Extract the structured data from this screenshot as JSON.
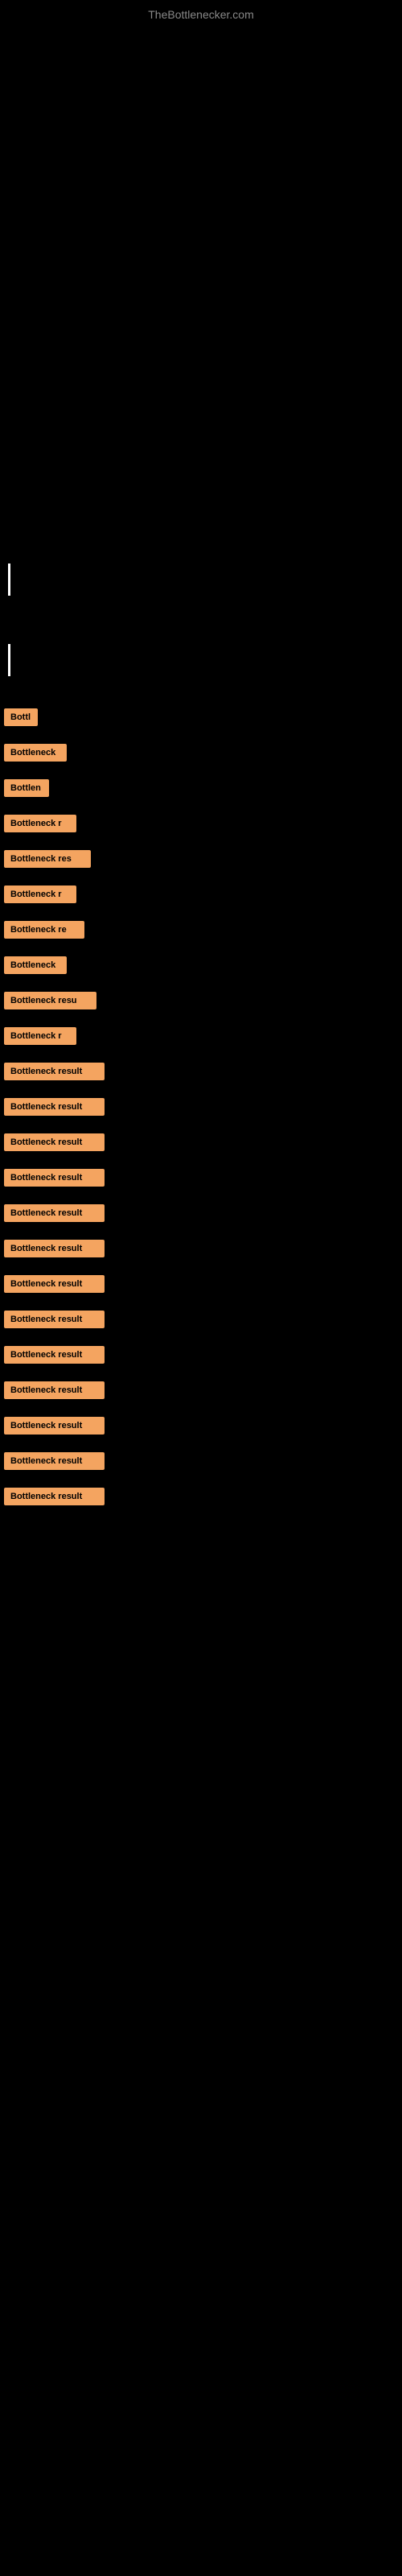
{
  "header": {
    "title": "TheBottlenecker.com"
  },
  "results": [
    {
      "label": "Bottl",
      "width": 42
    },
    {
      "label": "Bottleneck",
      "width": 78
    },
    {
      "label": "Bottlen",
      "width": 56
    },
    {
      "label": "Bottleneck r",
      "width": 90
    },
    {
      "label": "Bottleneck res",
      "width": 108
    },
    {
      "label": "Bottleneck r",
      "width": 90
    },
    {
      "label": "Bottleneck re",
      "width": 100
    },
    {
      "label": "Bottleneck",
      "width": 78
    },
    {
      "label": "Bottleneck resu",
      "width": 115
    },
    {
      "label": "Bottleneck r",
      "width": 90
    },
    {
      "label": "Bottleneck result",
      "width": 125
    },
    {
      "label": "Bottleneck result",
      "width": 125
    },
    {
      "label": "Bottleneck result",
      "width": 125
    },
    {
      "label": "Bottleneck result",
      "width": 125
    },
    {
      "label": "Bottleneck result",
      "width": 125
    },
    {
      "label": "Bottleneck result",
      "width": 125
    },
    {
      "label": "Bottleneck result",
      "width": 125
    },
    {
      "label": "Bottleneck result",
      "width": 125
    },
    {
      "label": "Bottleneck result",
      "width": 125
    },
    {
      "label": "Bottleneck result",
      "width": 125
    },
    {
      "label": "Bottleneck result",
      "width": 125
    },
    {
      "label": "Bottleneck result",
      "width": 125
    },
    {
      "label": "Bottleneck result",
      "width": 125
    }
  ],
  "colors": {
    "background": "#000000",
    "badge": "#f4a460",
    "title": "#888888",
    "cursor": "#ffffff"
  }
}
